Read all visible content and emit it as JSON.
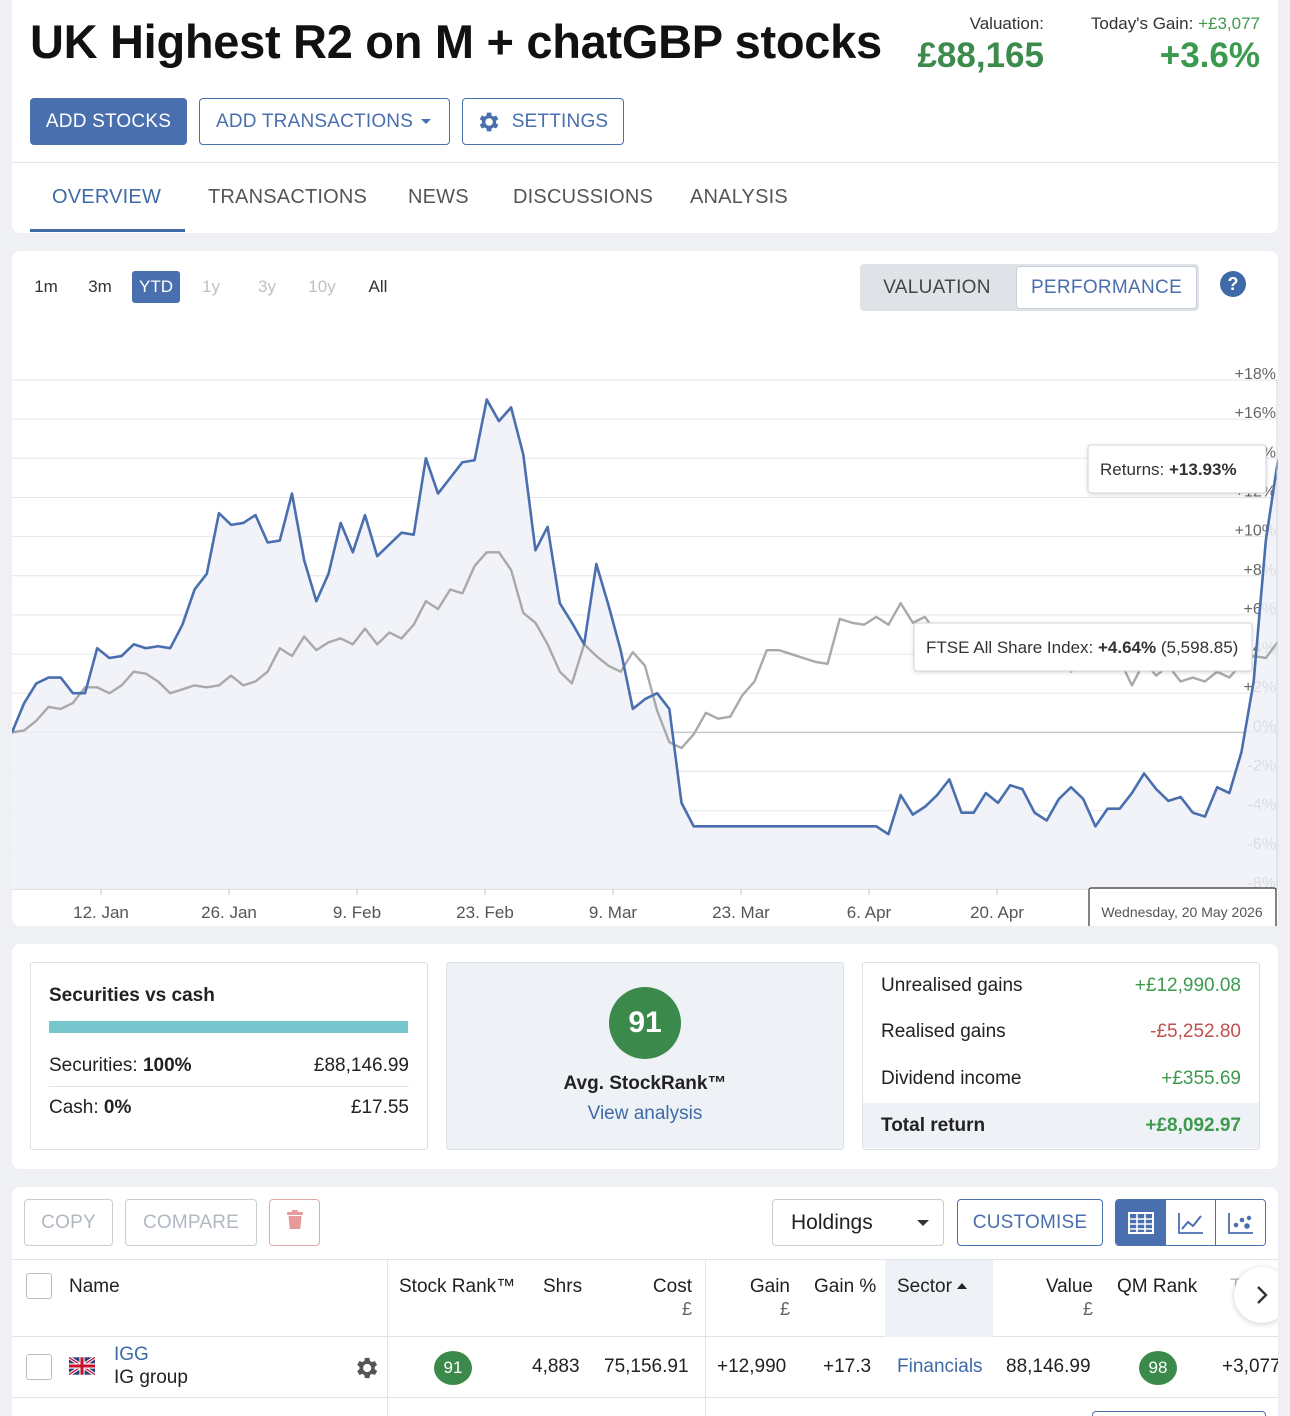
{
  "header": {
    "title": "UK Highest R2 on M + chatGBP stocks",
    "valuation_label": "Valuation:",
    "valuation_value": "£88,165",
    "gain_label": "Today's Gain:",
    "gain_amount": "+£3,077",
    "gain_pct": "+3.6%",
    "buttons": {
      "add_stocks": "ADD STOCKS",
      "add_transactions": "ADD TRANSACTIONS",
      "settings": "SETTINGS"
    },
    "tabs": [
      "OVERVIEW",
      "TRANSACTIONS",
      "NEWS",
      "DISCUSSIONS",
      "ANALYSIS"
    ],
    "active_tab": "OVERVIEW"
  },
  "chart_controls": {
    "ranges": [
      "1m",
      "3m",
      "YTD",
      "1y",
      "3y",
      "10y",
      "All"
    ],
    "active_range": "YTD",
    "disabled_ranges": [
      "1y",
      "3y",
      "10y"
    ],
    "modes": [
      "VALUATION",
      "PERFORMANCE"
    ],
    "active_mode": "PERFORMANCE",
    "help": "?"
  },
  "chart_data": {
    "type": "line",
    "x_labels": [
      "12. Jan",
      "26. Jan",
      "9. Feb",
      "23. Feb",
      "9. Mar",
      "23. Mar",
      "6. Apr",
      "20. Apr"
    ],
    "y_ticks": [
      "+18%",
      "+16%",
      "+14%",
      "+12%",
      "+10%",
      "+8%",
      "+6%",
      "+4%",
      "+2%",
      "0%",
      "-2%",
      "-4%",
      "-6%",
      "-8%"
    ],
    "ylim": [
      -8,
      18
    ],
    "series": [
      {
        "name": "Returns",
        "color": "#4a6fae",
        "values": [
          0,
          1.5,
          2.5,
          2.8,
          2.8,
          2,
          2,
          4.3,
          3.8,
          3.9,
          4.5,
          4.3,
          4.4,
          4.3,
          5.5,
          7.3,
          8.1,
          11.2,
          10.6,
          10.7,
          11.1,
          9.7,
          9.8,
          12.2,
          8.8,
          6.7,
          8.1,
          10.7,
          9.2,
          11.1,
          9,
          9.6,
          10.2,
          10.1,
          14,
          12.2,
          13,
          13.8,
          13.9,
          17,
          15.9,
          16.6,
          14.2,
          9.3,
          10.5,
          6.6,
          5.6,
          4.5,
          8.6,
          6.5,
          4.2,
          1.2,
          1.7,
          2,
          1.2,
          -3.6,
          -4.8,
          -4.8,
          -4.8,
          -4.8,
          -4.8,
          -4.8,
          -4.8,
          -4.8,
          -4.8,
          -4.8,
          -4.8,
          -4.8,
          -4.8,
          -4.8,
          -4.8,
          -4.8,
          -5.2,
          -3.2,
          -4.2,
          -3.8,
          -3.2,
          -2.4,
          -4.1,
          -4.1,
          -3.1,
          -3.6,
          -2.7,
          -2.9,
          -4.1,
          -4.5,
          -3.4,
          -2.8,
          -3.4,
          -4.8,
          -3.9,
          -3.9,
          -3.1,
          -2.1,
          -2.9,
          -3.5,
          -3.3,
          -4.1,
          -4.3,
          -2.8,
          -3.1,
          -1,
          2.6,
          9.8,
          13.93
        ]
      },
      {
        "name": "FTSE All Share Index",
        "color": "#a9a9a9",
        "values": [
          0,
          0.1,
          0.6,
          1.3,
          1.2,
          1.5,
          2.3,
          2.3,
          2,
          2.4,
          3.1,
          3,
          2.6,
          2,
          2.2,
          2.4,
          2.3,
          2.4,
          2.9,
          2.4,
          2.6,
          3.1,
          4.3,
          3.9,
          4.9,
          4.2,
          4.6,
          4.8,
          4.5,
          5.3,
          4.5,
          5.1,
          4.8,
          5.5,
          6.7,
          6.3,
          7.3,
          7.1,
          8.5,
          9.2,
          9.2,
          8.3,
          6.1,
          5.6,
          4.5,
          3.1,
          2.5,
          4.5,
          3.9,
          3.4,
          3.1,
          4.1,
          3.4,
          1.1,
          -0.5,
          -0.8,
          -0.1,
          1,
          0.7,
          0.8,
          1.9,
          2.6,
          4.2,
          4.2,
          4,
          3.8,
          3.6,
          3.5,
          5.8,
          5.6,
          5.5,
          5.9,
          5.5,
          6.6,
          5.6,
          5.9,
          5,
          4.7,
          5.3,
          4.5,
          3.9,
          4.3,
          4.8,
          5,
          4.7,
          4.6,
          4.5,
          3.1,
          3.7,
          3.6,
          3.3,
          3.7,
          2.4,
          3.6,
          2.9,
          3.4,
          2.6,
          2.8,
          2.6,
          3.1,
          2.8,
          3.5,
          3.9,
          3.8,
          4.64
        ]
      }
    ],
    "tooltips": {
      "returns": {
        "label": "Returns:",
        "value": "+13.93%"
      },
      "index": {
        "label": "FTSE All Share Index:",
        "value": "+4.64%",
        "extra": "(5,598.85)"
      },
      "date": "Wednesday, 20 May 2026"
    }
  },
  "summary": {
    "securities_title": "Securities vs cash",
    "securities_label": "Securities:",
    "securities_pct": "100%",
    "securities_value": "£88,146.99",
    "cash_label": "Cash:",
    "cash_pct": "0%",
    "cash_value": "£17.55",
    "stockrank": "91",
    "stockrank_label": "Avg. StockRank™",
    "view_analysis": "View analysis",
    "returns": [
      {
        "label": "Unrealised gains",
        "value": "+£12,990.08",
        "tone": "pos"
      },
      {
        "label": "Realised gains",
        "value": "-£5,252.80",
        "tone": "neg"
      },
      {
        "label": "Dividend income",
        "value": "+£355.69",
        "tone": "pos"
      },
      {
        "label": "Total return",
        "value": "+£8,092.97",
        "tone": "pos"
      }
    ]
  },
  "holdings": {
    "toolbar": {
      "copy": "COPY",
      "compare": "COMPARE",
      "view_select": "Holdings",
      "customise": "CUSTOMISE"
    },
    "columns": {
      "name": "Name",
      "stock_rank": "Stock Rank™",
      "shrs": "Shrs",
      "cost": "Cost",
      "cost_unit": "£",
      "gain": "Gain",
      "gain_unit": "£",
      "gain_pct": "Gain %",
      "sector": "Sector",
      "value": "Value",
      "value_unit": "£",
      "qm_rank": "QM Rank",
      "today": "Today",
      "today_unit": "£"
    },
    "rows": [
      {
        "ticker": "IGG",
        "company": "IG group",
        "stock_rank": "91",
        "shrs": "4,883",
        "cost": "75,156.91",
        "gain": "+12,990",
        "gain_pct": "+17.3",
        "sector": "Financials",
        "value": "88,146.99",
        "qm_rank": "98",
        "today": "+3,077"
      }
    ]
  }
}
